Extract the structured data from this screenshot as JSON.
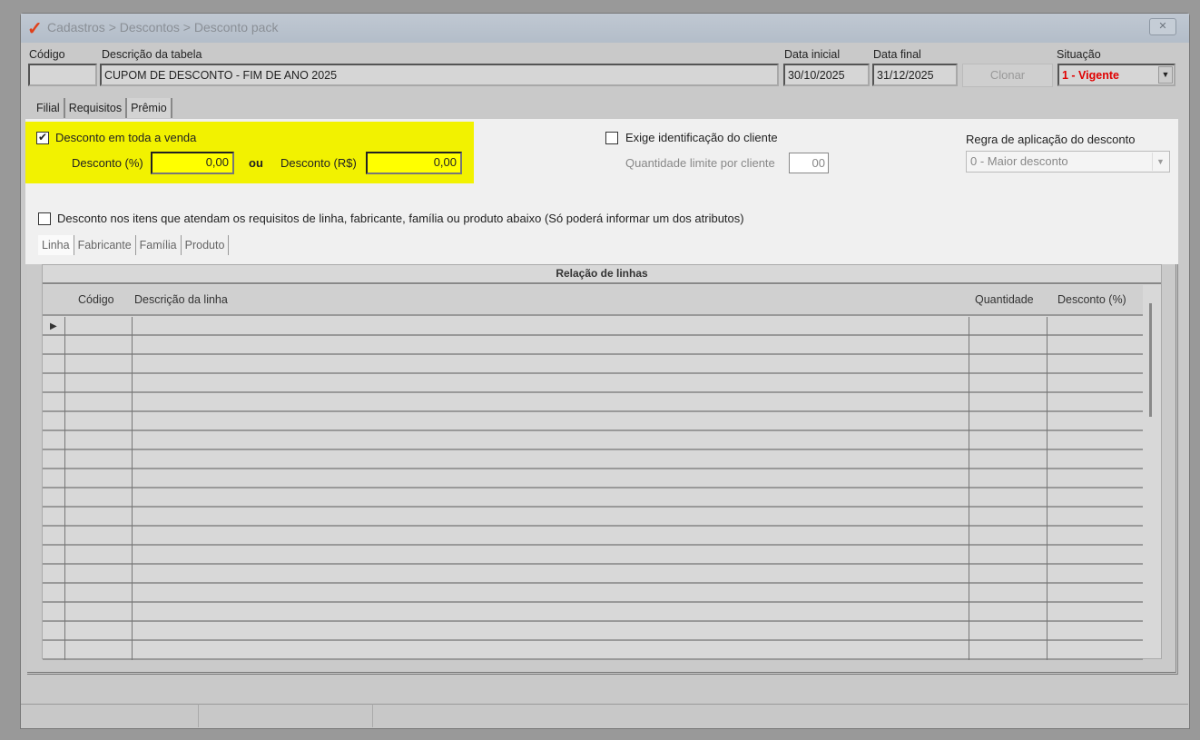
{
  "window": {
    "breadcrumb": "Cadastros > Descontos > Desconto pack",
    "close_label": "✕"
  },
  "header": {
    "codigo_label": "Código",
    "codigo_value": "",
    "descricao_label": "Descrição da tabela",
    "descricao_value": "CUPOM DE DESCONTO - FIM DE ANO 2025",
    "data_inicial_label": "Data inicial",
    "data_inicial_value": "30/10/2025",
    "data_final_label": "Data final",
    "data_final_value": "31/12/2025",
    "clonar_label": "Clonar",
    "situacao_label": "Situação",
    "situacao_value": "1 - Vigente"
  },
  "tabs": [
    "Filial",
    "Requisitos",
    "Prêmio"
  ],
  "premio": {
    "desconto_venda_label": "Desconto em toda a venda",
    "desconto_venda_checked": true,
    "desconto_pct_label": "Desconto (%)",
    "desconto_pct_value": "0,00",
    "ou_label": "ou",
    "desconto_rs_label": "Desconto (R$)",
    "desconto_rs_value": "0,00",
    "exige_label": "Exige identificação do cliente",
    "exige_checked": false,
    "qtd_label": "Quantidade limite por cliente",
    "qtd_value": "00",
    "regra_label": "Regra de aplicação do desconto",
    "regra_value": "0 - Maior desconto",
    "itens_label": "Desconto nos itens que atendam os requisitos de linha, fabricante, família ou produto abaixo (Só poderá informar um dos atributos)",
    "itens_checked": false
  },
  "subtabs": [
    "Linha",
    "Fabricante",
    "Família",
    "Produto"
  ],
  "grid": {
    "title": "Relação de linhas",
    "columns": [
      "Código",
      "Descrição da linha",
      "Quantidade",
      "Desconto (%)"
    ],
    "row_count": 18
  },
  "colors": {
    "highlight": "#f2f200",
    "situacao": "#e00000",
    "logo": "#e0401a"
  }
}
